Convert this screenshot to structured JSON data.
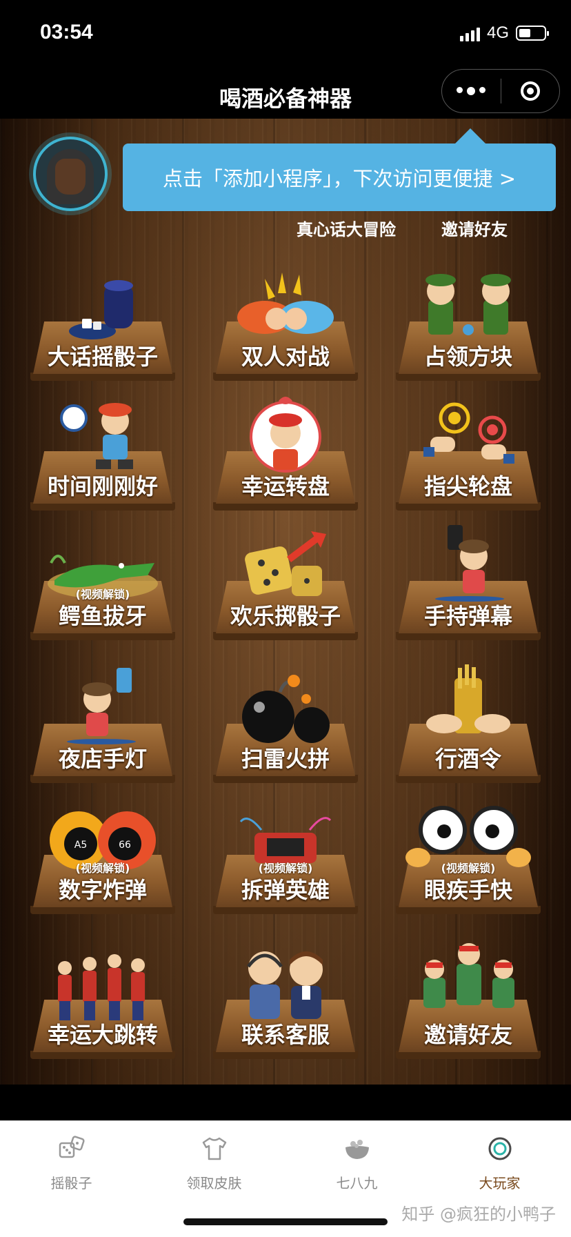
{
  "status_bar": {
    "time": "03:54",
    "network": "4G"
  },
  "nav": {
    "title": "喝酒必备神器"
  },
  "tip": {
    "text": "点击「添加小程序」，下次访问更便捷 >"
  },
  "top_links": [
    "真心话大冒险",
    "邀请好友"
  ],
  "games": [
    {
      "label": "大话摇骰子",
      "lock": "",
      "icon": "dice-cup-icon"
    },
    {
      "label": "双人对战",
      "lock": "",
      "icon": "fist-bump-icon"
    },
    {
      "label": "占领方块",
      "lock": "",
      "icon": "soldiers-icon"
    },
    {
      "label": "时间刚刚好",
      "lock": "",
      "icon": "alarm-clock-icon"
    },
    {
      "label": "幸运转盘",
      "lock": "",
      "icon": "lucky-wheel-icon"
    },
    {
      "label": "指尖轮盘",
      "lock": "",
      "icon": "fingertip-wheel-icon"
    },
    {
      "label": "鳄鱼拔牙",
      "lock": "(视频解锁)",
      "icon": "crocodile-icon"
    },
    {
      "label": "欢乐掷骰子",
      "lock": "",
      "icon": "dice-icon"
    },
    {
      "label": "手持弹幕",
      "lock": "",
      "icon": "phone-barrage-icon"
    },
    {
      "label": "夜店手灯",
      "lock": "",
      "icon": "phone-light-icon"
    },
    {
      "label": "扫雷火拼",
      "lock": "",
      "icon": "bomb-icon"
    },
    {
      "label": "行酒令",
      "lock": "",
      "icon": "drinking-sticks-icon"
    },
    {
      "label": "数字炸弹",
      "lock": "(视频解锁)",
      "icon": "number-bomb-icon"
    },
    {
      "label": "拆弹英雄",
      "lock": "(视频解锁)",
      "icon": "dynamite-icon"
    },
    {
      "label": "眼疾手快",
      "lock": "(视频解锁)",
      "icon": "eyes-icon"
    },
    {
      "label": "幸运大跳转",
      "lock": "",
      "icon": "party-icon"
    },
    {
      "label": "联系客服",
      "lock": "",
      "icon": "customer-service-icon"
    },
    {
      "label": "邀请好友",
      "lock": "",
      "icon": "dancers-icon"
    }
  ],
  "tabbar": [
    {
      "label": "摇骰子",
      "icon": "dice-icon",
      "active": false
    },
    {
      "label": "领取皮肤",
      "icon": "tshirt-icon",
      "active": false
    },
    {
      "label": "七八九",
      "icon": "bowl-icon",
      "active": false
    },
    {
      "label": "大玩家",
      "icon": "ring-icon",
      "active": true
    }
  ],
  "watermark": "知乎 @疯狂的小鸭子",
  "colors": {
    "tip_bg": "#55b3e3",
    "active_tab": "#7a4a1e",
    "wood": "#6b4220"
  }
}
